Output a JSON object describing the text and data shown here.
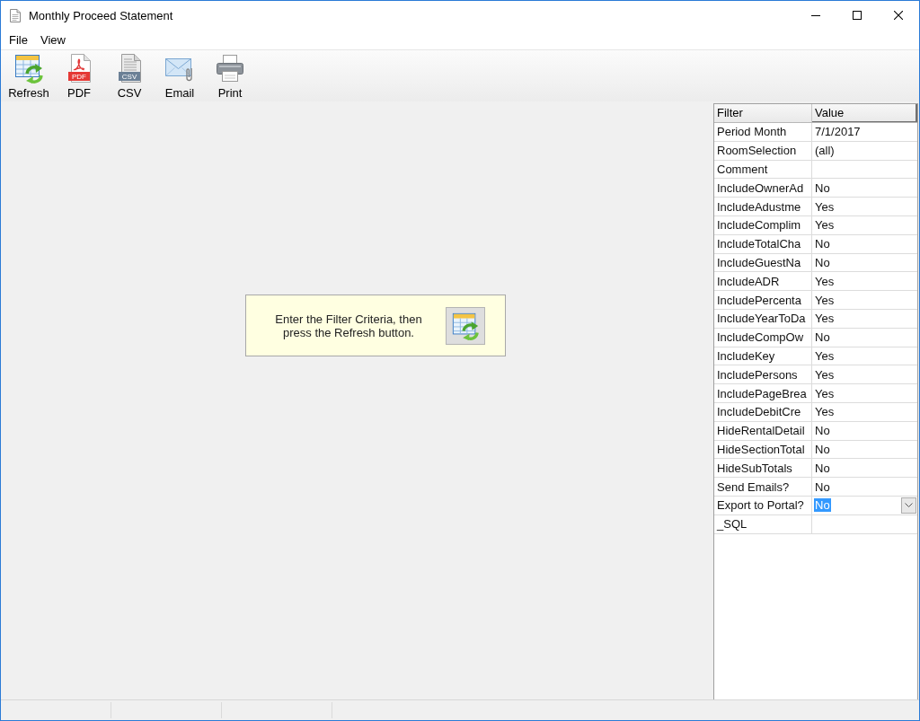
{
  "window": {
    "title": "Monthly Proceed Statement"
  },
  "menu": [
    "File",
    "View"
  ],
  "toolbar": [
    {
      "kind": "refresh",
      "label": "Refresh"
    },
    {
      "kind": "pdf",
      "label": "PDF",
      "badge": "PDF"
    },
    {
      "kind": "csv",
      "label": "CSV",
      "badge": "CSV"
    },
    {
      "kind": "email",
      "label": "Email"
    },
    {
      "kind": "print",
      "label": "Print"
    }
  ],
  "message": {
    "text": "Enter the Filter Criteria, then press the Refresh button."
  },
  "grid": {
    "columns": [
      "Filter",
      "Value"
    ],
    "rows": [
      {
        "filter": "Period Month",
        "value": "7/1/2017",
        "selected": false
      },
      {
        "filter": "RoomSelection",
        "value": "(all)",
        "selected": false
      },
      {
        "filter": "Comment",
        "selected": false
      },
      {
        "filter": "IncludeOwnerAd",
        "value": "No",
        "selected": false
      },
      {
        "filter": "IncludeAdustme",
        "value": "Yes",
        "selected": false
      },
      {
        "filter": "IncludeComplim",
        "value": "Yes",
        "selected": false
      },
      {
        "filter": "IncludeTotalCha",
        "value": "No",
        "selected": false
      },
      {
        "filter": "IncludeGuestNa",
        "value": "No",
        "selected": false
      },
      {
        "filter": "IncludeADR",
        "value": "Yes",
        "selected": false
      },
      {
        "filter": "IncludePercenta",
        "value": "Yes",
        "selected": false
      },
      {
        "filter": "IncludeYearToDa",
        "value": "Yes",
        "selected": false
      },
      {
        "filter": "IncludeCompOw",
        "value": "No",
        "selected": false
      },
      {
        "filter": "IncludeKey",
        "value": "Yes",
        "selected": false
      },
      {
        "filter": "IncludePersons",
        "value": "Yes",
        "selected": false
      },
      {
        "filter": "IncludePageBrea",
        "value": "Yes",
        "selected": false
      },
      {
        "filter": "IncludeDebitCre",
        "value": "Yes",
        "selected": false
      },
      {
        "filter": "HideRentalDetail",
        "value": "No",
        "selected": false
      },
      {
        "filter": "HideSectionTotal",
        "value": "No",
        "selected": false
      },
      {
        "filter": "HideSubTotals",
        "value": "No",
        "selected": false
      },
      {
        "filter": "Send Emails?",
        "value": "No",
        "selected": false
      },
      {
        "filter": "Export to Portal?",
        "value": "No",
        "selected": true
      },
      {
        "filter": "_SQL",
        "selected": false
      }
    ]
  }
}
